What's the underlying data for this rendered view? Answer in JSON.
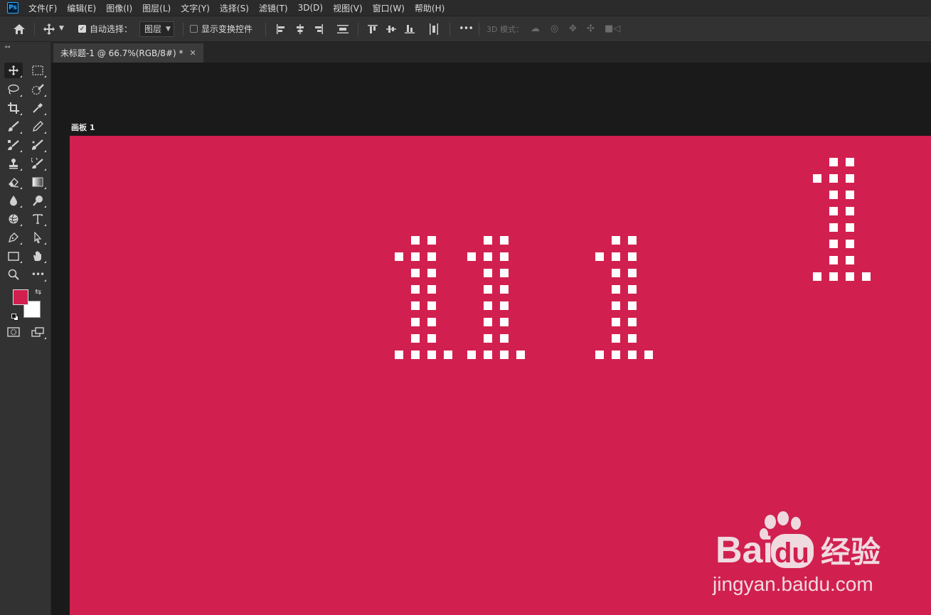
{
  "app": {
    "logo": "Ps"
  },
  "menu": [
    "文件(F)",
    "编辑(E)",
    "图像(I)",
    "图层(L)",
    "文字(Y)",
    "选择(S)",
    "滤镜(T)",
    "3D(D)",
    "视图(V)",
    "窗口(W)",
    "帮助(H)"
  ],
  "options": {
    "auto_select_label": "自动选择：",
    "auto_select_checked": true,
    "auto_select_target": "图层",
    "show_transform_label": "显示变换控件",
    "show_transform_checked": false,
    "more": "•••",
    "mode_3d_label": "3D 模式："
  },
  "document": {
    "tab_title": "未标题-1 @ 66.7%(RGB/8#) *",
    "artboard_name": "画板 1",
    "background_color": "#d1204f",
    "pixel_color": "#ffffff",
    "pixel_glyph": [
      [
        0,
        1,
        1,
        0
      ],
      [
        1,
        1,
        1,
        0
      ],
      [
        0,
        1,
        1,
        0
      ],
      [
        0,
        1,
        1,
        0
      ],
      [
        0,
        1,
        1,
        0
      ],
      [
        0,
        1,
        1,
        0
      ],
      [
        0,
        1,
        1,
        0
      ],
      [
        1,
        1,
        1,
        1
      ]
    ]
  },
  "colors": {
    "foreground": "#d1204f",
    "background": "#ffffff",
    "accent": "#31a8ff"
  },
  "watermark": {
    "brand_left": "Bai",
    "brand_right": "du",
    "brand_cn": "经验",
    "url": "jingyan.baidu.com"
  }
}
